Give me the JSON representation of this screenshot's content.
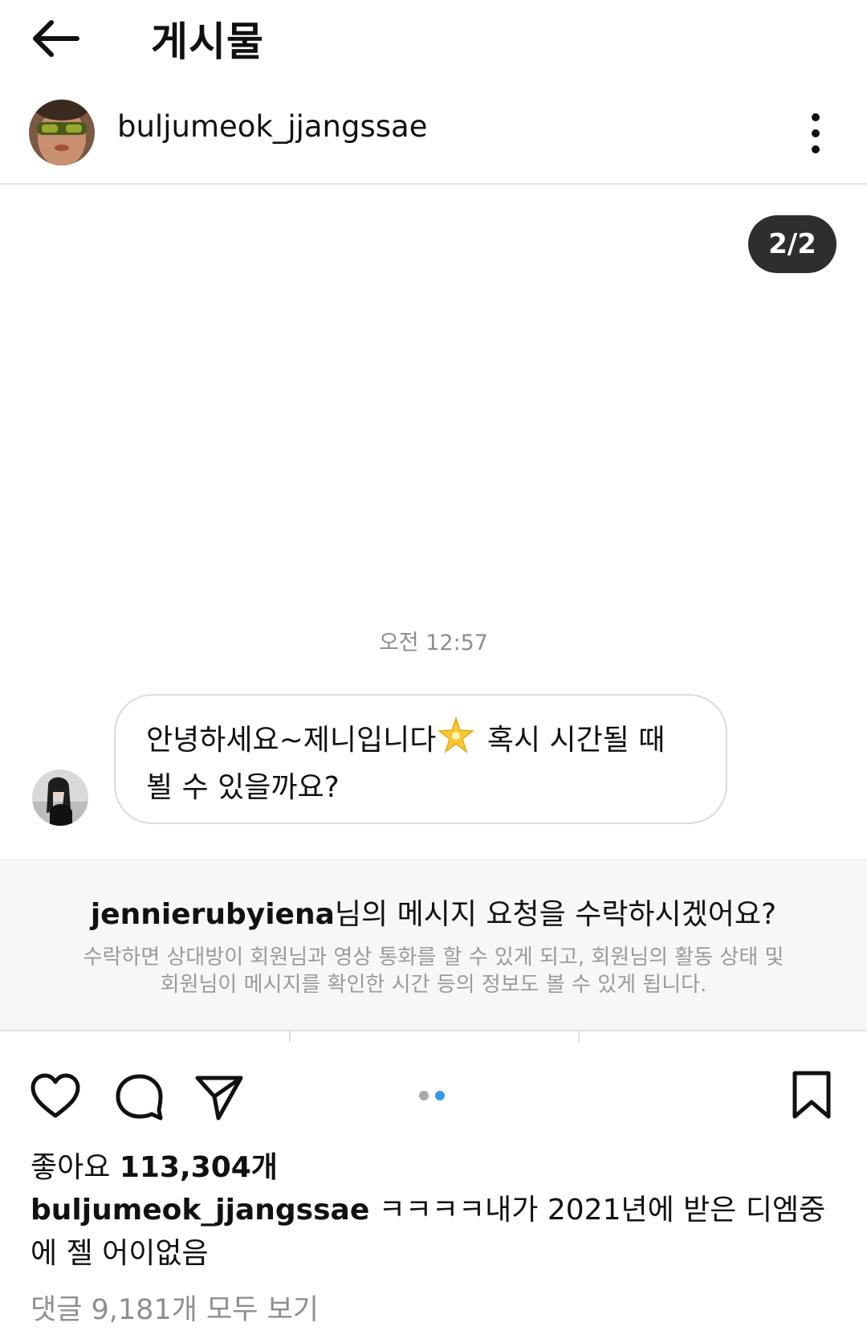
{
  "topbar": {
    "back_icon": "arrow-left-icon",
    "title": "게시물"
  },
  "post": {
    "author": "buljumeok_jjangssae",
    "more_icon": "more-vertical-icon",
    "image_counter": "2/2"
  },
  "dm_screenshot": {
    "time": "오전 12:57",
    "message_line1_before": "안녕하세요~제니입니다",
    "message_emoji": "star-sparkle-icon",
    "message_line1_after": " 혹시 시간될 때",
    "message_line2": "뵐 수 있을까요?",
    "request_username": "jennierubyiena",
    "request_text": "님의 메시지 요청을 수락하시겠어요?",
    "request_description_line1": "수락하면 상대방이 회원님과 영상 통화를 할 수 있게 되고, 회원님의 활동 상태 및",
    "request_description_line2": "회원님이 메시지를 확인한 시간 등의 정보도 볼 수 있게 됩니다."
  },
  "actions": {
    "like_icon": "heart-icon",
    "comment_icon": "comment-icon",
    "share_icon": "send-icon",
    "save_icon": "bookmark-icon",
    "active_dot_color": "#3897f0",
    "inactive_dot_color": "#a8a8a8",
    "active_slide": 2,
    "slide_count": 2
  },
  "likes": {
    "label": "좋아요",
    "count": "113,304개"
  },
  "caption": {
    "user": "buljumeok_jjangssae",
    "text": " ㅋㅋㅋㅋ내가 2021년에 받은 디엠중에 젤 어이없음"
  },
  "comments": {
    "view_all": "댓글 9,181개 모두 보기"
  }
}
